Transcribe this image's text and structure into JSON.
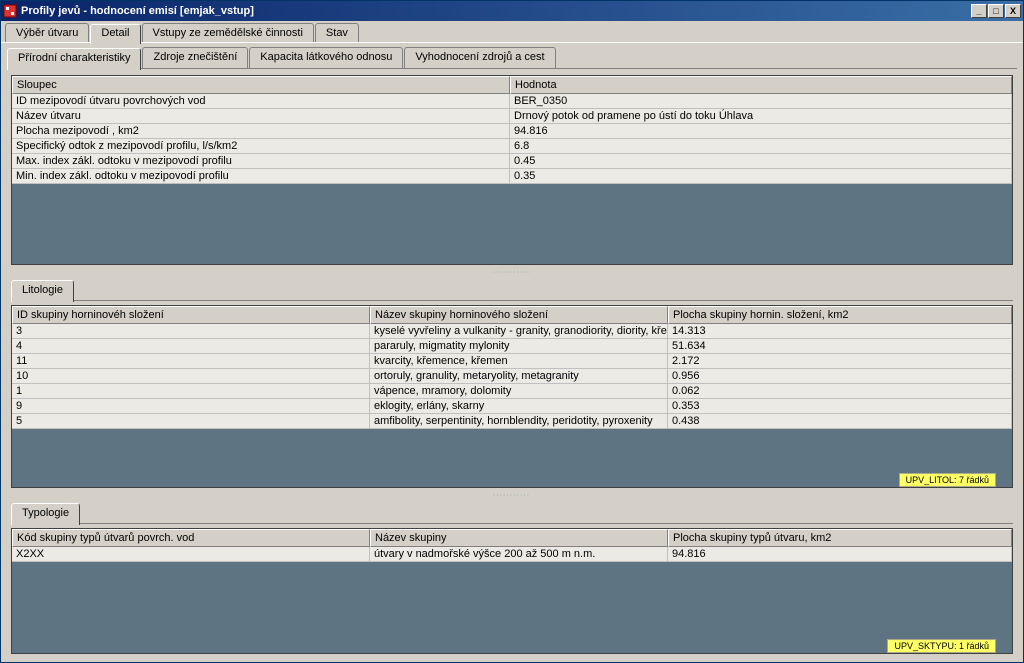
{
  "title": "Profily jevů - hodnocení emisí [emjak_vstup]",
  "winbtn": {
    "min": "_",
    "max": "□",
    "close": "X"
  },
  "maintabs": [
    "Výběr útvaru",
    "Detail",
    "Vstupy ze zemědělské činnosti",
    "Stav"
  ],
  "subtabs": [
    "Přírodní charakteristiky",
    "Zdroje znečištění",
    "Kapacita látkového odnosu",
    "Vyhodnocení zdrojů a cest"
  ],
  "table1": {
    "headers": [
      "Sloupec",
      "Hodnota"
    ],
    "rows": [
      [
        "ID mezipovodí útvaru povrchových vod",
        "BER_0350"
      ],
      [
        "Název útvaru",
        "Drnový potok od pramene po ústí do toku Úhlava"
      ],
      [
        "Plocha mezipovodí , km2",
        "94.816"
      ],
      [
        "Specifický odtok z mezipovodí profilu, l/s/km2",
        "6.8"
      ],
      [
        "Max. index zákl. odtoku v mezipovodí profilu",
        "0.45"
      ],
      [
        "Min. index zákl. odtoku v mezipovodí profilu",
        "0.35"
      ]
    ]
  },
  "section2": {
    "label": "Litologie"
  },
  "table2": {
    "headers": [
      "ID skupiny horninovéh složení",
      "Název skupiny horninového složení",
      "Plocha skupiny hornin. složení, km2"
    ],
    "rows": [
      [
        "3",
        "kyselé vyvřeliny a vulkanity - granity, granodiority, diority, křemenné diority, mon",
        "14.313"
      ],
      [
        "4",
        "pararuly, migmatity mylonity",
        "51.634"
      ],
      [
        "11",
        "kvarcity, křemence, křemen",
        "2.172"
      ],
      [
        "10",
        "ortoruly, granulity, metaryolity, metagranity",
        "0.956"
      ],
      [
        "1",
        "vápence, mramory, dolomity",
        "0.062"
      ],
      [
        "9",
        "eklogity, erlány, skarny",
        "0.353"
      ],
      [
        "5",
        "amfibolity, serpentinity, hornblendity, peridotity, pyroxenity",
        "0.438"
      ]
    ],
    "status": "UPV_LITOL: 7 řádků"
  },
  "section3": {
    "label": "Typologie"
  },
  "table3": {
    "headers": [
      "Kód skupiny typů útvarů povrch. vod",
      "Název skupiny",
      "Plocha skupiny typů útvaru, km2"
    ],
    "rows": [
      [
        "X2XX",
        "útvary v nadmořské výšce 200 až 500 m n.m.",
        "94.816"
      ]
    ],
    "status": "UPV_SKTYPU: 1 řádků"
  }
}
